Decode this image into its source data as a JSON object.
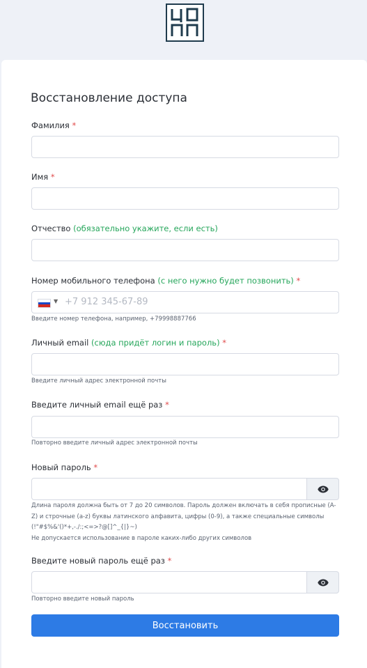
{
  "form": {
    "title": "Восстановление доступа",
    "lastname": {
      "label": "Фамилия",
      "req": "*"
    },
    "firstname": {
      "label": "Имя",
      "req": "*"
    },
    "patronymic": {
      "label": "Отчество",
      "hint": "(обязательно укажите, если есть)"
    },
    "phone": {
      "label": "Номер мобильного телефона",
      "hint": "(с него нужно будет позвонить)",
      "req": "*",
      "placeholder": "+7 912 345-67-89",
      "help": "Введите номер телефона, например, +79998887766",
      "country_caret": "▼",
      "flag_colors": [
        "#ffffff",
        "#1b49c5",
        "#d52b1e"
      ]
    },
    "email": {
      "label": "Личный email",
      "hint": "(сюда придёт логин и пароль)",
      "req": "*",
      "help": "Введите личный адрес электронной почты"
    },
    "email_repeat": {
      "label": "Введите личный email ещё раз",
      "req": "*",
      "help": "Повторно введите личный адрес электронной почты"
    },
    "password": {
      "label": "Новый пароль",
      "req": "*",
      "help_line1": "Длина пароля должна быть от 7 до 20 символов. Пароль должен включать в себя прописные (A-Z) и строчные (a-z) буквы латинского алфавита, цифры (0-9), а также специальные символы (!\"#$%&'()*+,-./:;<=>?@[]^_{|}~)",
      "help_line2": "Не допускается использование в пароле каких-либо других символов",
      "icon": "eye-icon"
    },
    "password_repeat": {
      "label": "Введите новый пароль ещё раз",
      "req": "*",
      "help": "Повторно введите новый пароль",
      "icon": "eye-icon"
    },
    "submit_label": "Восстановить"
  },
  "logo": {
    "letters": "ЦОПП",
    "color": "#1f3b4d"
  },
  "colors": {
    "accent": "#2d7be5",
    "hint": "#26a65b",
    "required": "#e14b4b"
  }
}
